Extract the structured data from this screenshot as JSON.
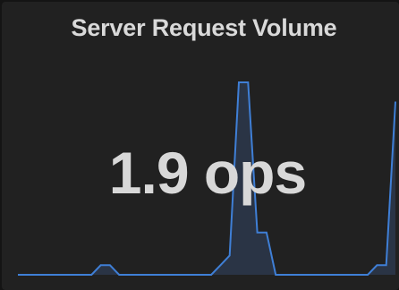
{
  "panel": {
    "title": "Server Request Volume",
    "value": "1.9 ops",
    "colors": {
      "background": "#212121",
      "line": "#3f7fd6",
      "fill": "#2a3445",
      "text": "#d8d8d8"
    }
  },
  "chart_data": {
    "type": "area",
    "y": [
      0,
      0,
      0,
      0,
      0,
      0,
      0,
      0,
      0,
      0.05,
      0.05,
      0,
      0,
      0,
      0,
      0,
      0,
      0,
      0,
      0,
      0,
      0,
      0.05,
      0.1,
      1.0,
      1.0,
      0.22,
      0.22,
      0,
      0,
      0,
      0,
      0,
      0,
      0,
      0,
      0,
      0,
      0,
      0.05,
      0.05,
      0.9
    ],
    "grid": false,
    "legend": "none"
  }
}
